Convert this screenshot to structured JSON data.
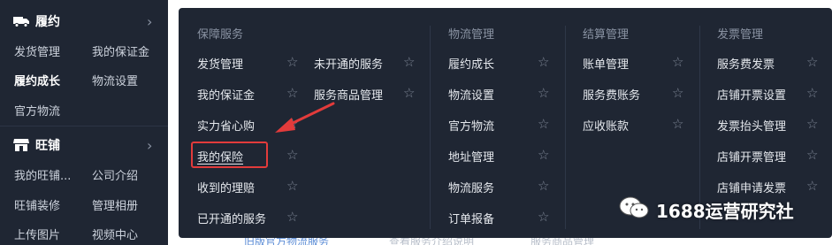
{
  "sidebar": {
    "sections": [
      {
        "title": "履约",
        "icon": "truck-icon"
      },
      {
        "title": "旺铺",
        "icon": "store-icon"
      }
    ],
    "fulfillment_links": [
      "发货管理",
      "我的保证金",
      "履约成长",
      "物流设置",
      "官方物流"
    ],
    "store_links": [
      "我的旺铺...",
      "公司介绍",
      "旺铺装修",
      "管理相册",
      "上传图片",
      "视频中心"
    ]
  },
  "panel": {
    "columns": [
      {
        "title": "保障服务",
        "items": [
          "发货管理",
          "我的保证金",
          "实力省心购",
          "我的保险",
          "收到的理赔",
          "已开通的服务"
        ]
      },
      {
        "title": "",
        "items": [
          "未开通的服务",
          "服务商品管理"
        ]
      },
      {
        "title": "物流管理",
        "items": [
          "履约成长",
          "物流设置",
          "官方物流",
          "地址管理",
          "物流服务",
          "订单报备"
        ]
      },
      {
        "title": "结算管理",
        "items": [
          "账单管理",
          "服务费账务",
          "应收账款"
        ]
      },
      {
        "title": "发票管理",
        "items": [
          "服务费发票",
          "店铺开票设置",
          "发票抬头管理",
          "店铺开票管理",
          "店铺申请发票"
        ]
      }
    ]
  },
  "background": {
    "bottom_texts": [
      "旧版官方物流服务",
      "查看服务介绍说明",
      "服务商品管理"
    ]
  },
  "watermark": {
    "text": "1688运营研究社",
    "icon": "wechat-icon"
  },
  "colors": {
    "panel_bg": "#1f2633",
    "highlight_red": "#e23b3b",
    "star_gray": "#7d8594"
  }
}
